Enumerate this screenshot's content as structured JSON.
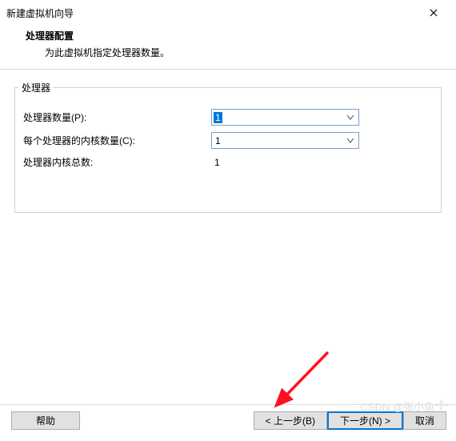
{
  "window": {
    "title": "新建虚拟机向导"
  },
  "header": {
    "title": "处理器配置",
    "subtitle": "为此虚拟机指定处理器数量。"
  },
  "group": {
    "legend": "处理器",
    "rows": {
      "processors_label": "处理器数量(P):",
      "processors_value": "1",
      "cores_label": "每个处理器的内核数量(C):",
      "cores_value": "1",
      "total_label": "处理器内核总数:",
      "total_value": "1"
    }
  },
  "buttons": {
    "help": "帮助",
    "back": "< 上一步(B)",
    "next": "下一步(N) >",
    "cancel": "取消"
  },
  "watermark": "CSDN @张小鱼༒"
}
